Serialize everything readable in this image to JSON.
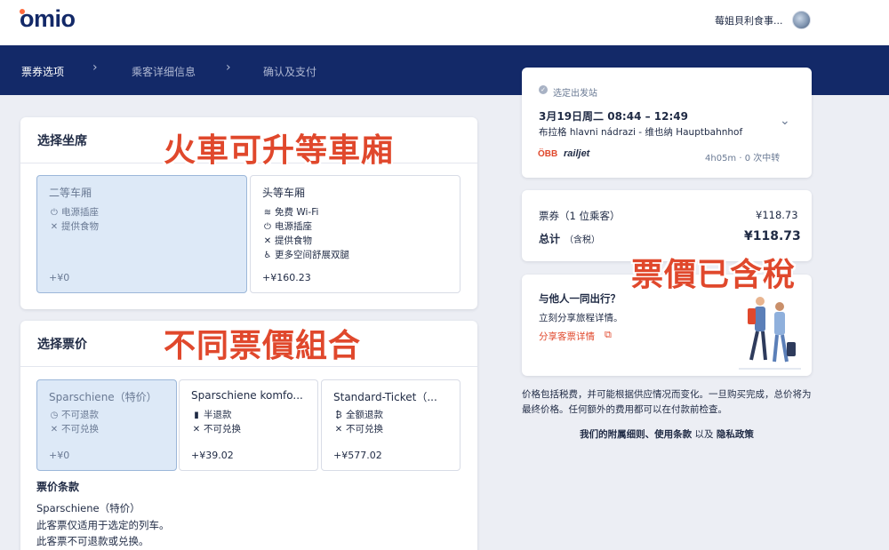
{
  "app": {
    "logo": "omio",
    "user_name": "莓姐貝利食事..."
  },
  "steps": [
    {
      "label": "票券选项",
      "active": true
    },
    {
      "label": "乘客详细信息",
      "active": false
    },
    {
      "label": "确认及支付",
      "active": false
    }
  ],
  "seat_section": {
    "title": "选择坐席",
    "options": [
      {
        "title": "二等车厢",
        "features": [
          {
            "icon": "plug-icon",
            "text": "电源插座"
          },
          {
            "icon": "cutlery-icon",
            "text": "提供食物"
          }
        ],
        "price": "+¥0",
        "selected": true
      },
      {
        "title": "头等车厢",
        "features": [
          {
            "icon": "wifi-icon",
            "text": "免费 Wi-Fi"
          },
          {
            "icon": "plug-icon",
            "text": "电源插座"
          },
          {
            "icon": "cutlery-icon",
            "text": "提供食物"
          },
          {
            "icon": "seat-icon",
            "text": "更多空间舒展双腿"
          }
        ],
        "price": "+¥160.23",
        "selected": false
      }
    ]
  },
  "fare_section": {
    "title": "选择票价",
    "options": [
      {
        "title": "Sparschiene（特价）",
        "features": [
          {
            "icon": "clock-icon",
            "text": "不可退款"
          },
          {
            "icon": "cross-icon",
            "text": "不可兑换"
          }
        ],
        "price": "+¥0",
        "selected": true
      },
      {
        "title": "Sparschiene komfo...",
        "features": [
          {
            "icon": "half-refund-icon",
            "text": "半退款"
          },
          {
            "icon": "cross-icon",
            "text": "不可兑换"
          }
        ],
        "price": "+¥39.02",
        "selected": false
      },
      {
        "title": "Standard-Ticket（...",
        "features": [
          {
            "icon": "refund-icon",
            "text": "全额退款"
          },
          {
            "icon": "cross-icon",
            "text": "不可兑换"
          }
        ],
        "price": "+¥577.02",
        "selected": false
      }
    ],
    "terms_title": "票价条款",
    "terms_lines": [
      "Sparschiene（特价）",
      "此客票仅适用于选定的列车。",
      "此客票不可退款或兑换。"
    ]
  },
  "overlays": {
    "seat": "火車可升等車廂",
    "fare": "不同票價組合",
    "price": "票價已含稅"
  },
  "trip": {
    "badge": "选定出发站",
    "date_time": "3月19日周二   08:44 – 12:49",
    "route": "布拉格 hlavni nádrazi  -  维也纳 Hauptbahnhof",
    "operator_obb": "ÖBB",
    "operator_railjet": "railjet",
    "duration": "4h05m · 0 次中转"
  },
  "price_summary": {
    "ticket_label": "票券（1 位乘客）",
    "ticket_value": "¥118.73",
    "total_label": "总计",
    "tax_note": "（含税）",
    "total_value": "¥118.73"
  },
  "share": {
    "title": "与他人一同出行？",
    "subtitle": "立刻分享旅程详情。",
    "link": "分享客票详情"
  },
  "disclaimer": "价格包括税费，并可能根据供应情况而变化。一旦购买完成，总价将为最终价格。任何额外的费用都可以在付款前检查。",
  "footer": {
    "terms": "我们的附属细则、使用条款",
    "and": "以及",
    "privacy": "隐私政策"
  },
  "colors": {
    "brand_navy": "#132968",
    "accent_orange": "#e0482c",
    "selected_bg": "#dde9f7"
  }
}
